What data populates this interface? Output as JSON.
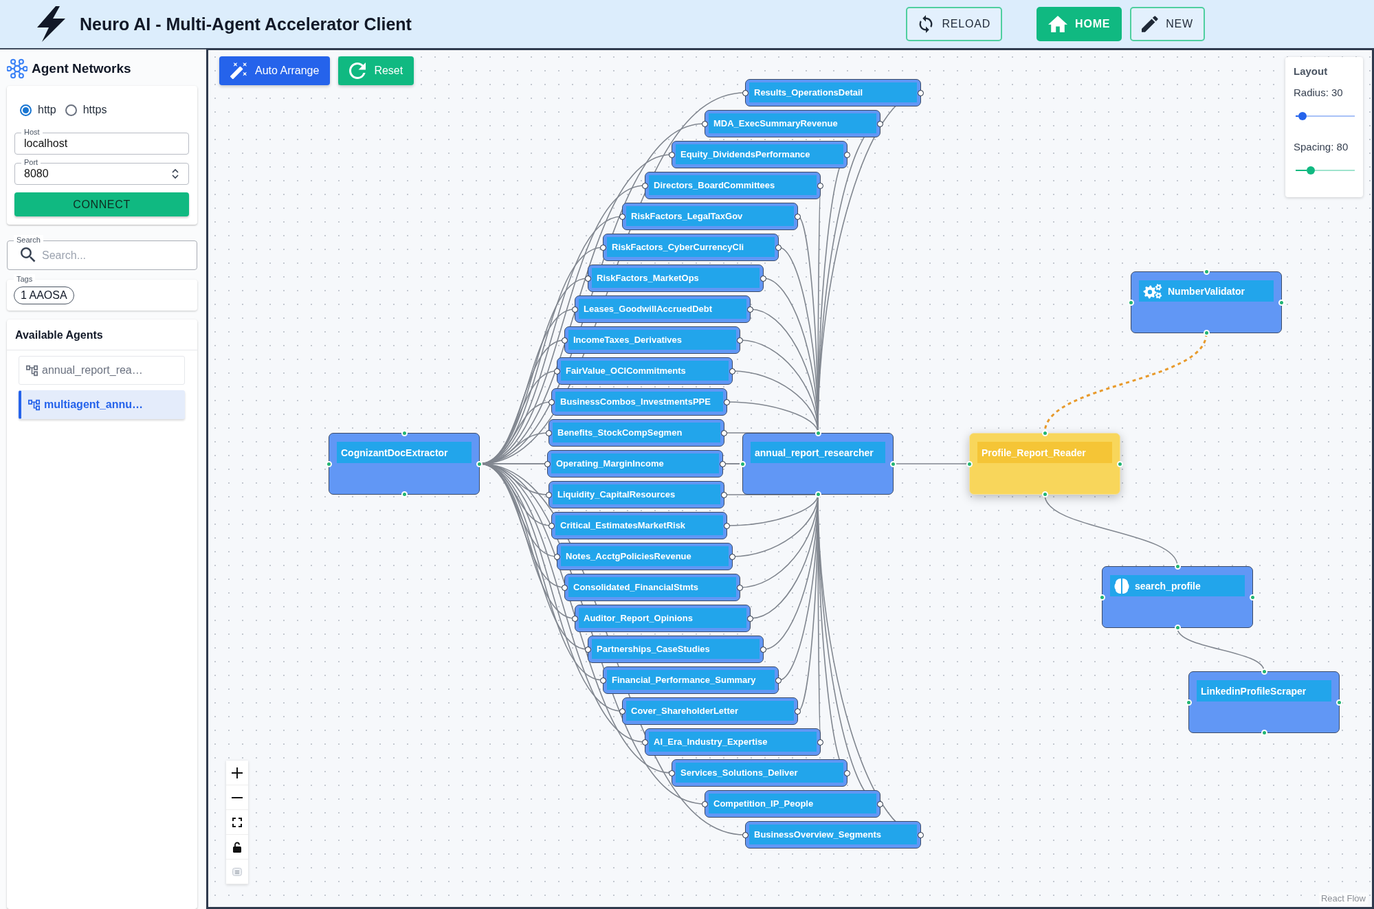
{
  "header": {
    "title": "Neuro AI - Multi-Agent Accelerator Client",
    "buttons": [
      {
        "label": "RELOAD",
        "primary": false
      },
      {
        "label": "HOME",
        "primary": true
      },
      {
        "label": "NEW",
        "primary": false
      }
    ]
  },
  "sidebar": {
    "title": "Agent Networks",
    "protocols": [
      {
        "label": "http",
        "selected": true
      },
      {
        "label": "https",
        "selected": false
      }
    ],
    "host": {
      "label": "Host",
      "value": "localhost"
    },
    "port": {
      "label": "Port",
      "value": "8080"
    },
    "connect_button": "CONNECT",
    "search": {
      "label": "Search",
      "placeholder": "Search..."
    },
    "tags": {
      "label": "Tags",
      "chips": [
        "1 AAOSA"
      ]
    },
    "agents": {
      "title": "Available Agents",
      "items": [
        {
          "label": "annual_report_rea…",
          "selected": false
        },
        {
          "label": "multiagent_annu…",
          "selected": true
        }
      ]
    }
  },
  "toolbar": [
    "Auto Arrange",
    "Reset"
  ],
  "layout_panel": {
    "title": "Layout",
    "sliders": [
      {
        "label": "Radius: 30",
        "level": 0.05,
        "color": "#2563eb"
      },
      {
        "label": "Spacing: 80",
        "level": 0.22,
        "color": "#10b981"
      }
    ]
  },
  "flow": {
    "root": {
      "label": "CognizantDocExtractor",
      "highlighted": false
    },
    "sections": [
      {
        "label": "Results_OperationsDetail",
        "highlighted": false
      },
      {
        "label": "MDA_ExecSummaryRevenue",
        "highlighted": false
      },
      {
        "label": "Equity_DividendsPerformance",
        "highlighted": false
      },
      {
        "label": "Directors_BoardCommittees",
        "highlighted": false
      },
      {
        "label": "RiskFactors_LegalTaxGov",
        "highlighted": false
      },
      {
        "label": "RiskFactors_CyberCurrencyCli",
        "highlighted": false
      },
      {
        "label": "RiskFactors_MarketOps",
        "highlighted": false
      },
      {
        "label": "Leases_GoodwillAccruedDebt",
        "highlighted": false
      },
      {
        "label": "IncomeTaxes_Derivatives",
        "highlighted": false
      },
      {
        "label": "FairValue_OCICommitments",
        "highlighted": false
      },
      {
        "label": "BusinessCombos_InvestmentsPPE",
        "highlighted": false
      },
      {
        "label": "Benefits_StockCompSegmen",
        "highlighted": false
      },
      {
        "label": "Operating_MarginIncome",
        "highlighted": false
      },
      {
        "label": "Liquidity_CapitalResources",
        "highlighted": false
      },
      {
        "label": "Critical_EstimatesMarketRisk",
        "highlighted": false
      },
      {
        "label": "Notes_AcctgPoliciesRevenue",
        "highlighted": false
      },
      {
        "label": "Consolidated_FinancialStmts",
        "highlighted": false
      },
      {
        "label": "Auditor_Report_Opinions",
        "highlighted": false
      },
      {
        "label": "Partnerships_CaseStudies",
        "highlighted": false
      },
      {
        "label": "Financial_Performance_Summary",
        "highlighted": false
      },
      {
        "label": "Cover_ShareholderLetter",
        "highlighted": false
      },
      {
        "label": "AI_Era_Industry_Expertise",
        "highlighted": false
      },
      {
        "label": "Services_Solutions_Deliver",
        "highlighted": false
      },
      {
        "label": "Competition_IP_People",
        "highlighted": false
      },
      {
        "label": "BusinessOverview_Segments",
        "highlighted": false
      }
    ],
    "researcher": {
      "label": "annual_report_researcher",
      "highlighted": false
    },
    "chain": [
      {
        "label": "Profile_Report_Reader",
        "highlighted": true,
        "kind": "plain"
      },
      {
        "label": "search_profile",
        "highlighted": false,
        "kind": "brain"
      },
      {
        "label": "LinkedinProfileScraper",
        "highlighted": false,
        "kind": "plain"
      }
    ],
    "tool": {
      "label": "NumberValidator",
      "highlighted": false,
      "kind": "gear",
      "dashed_link": true
    }
  },
  "attribution": "React Flow"
}
